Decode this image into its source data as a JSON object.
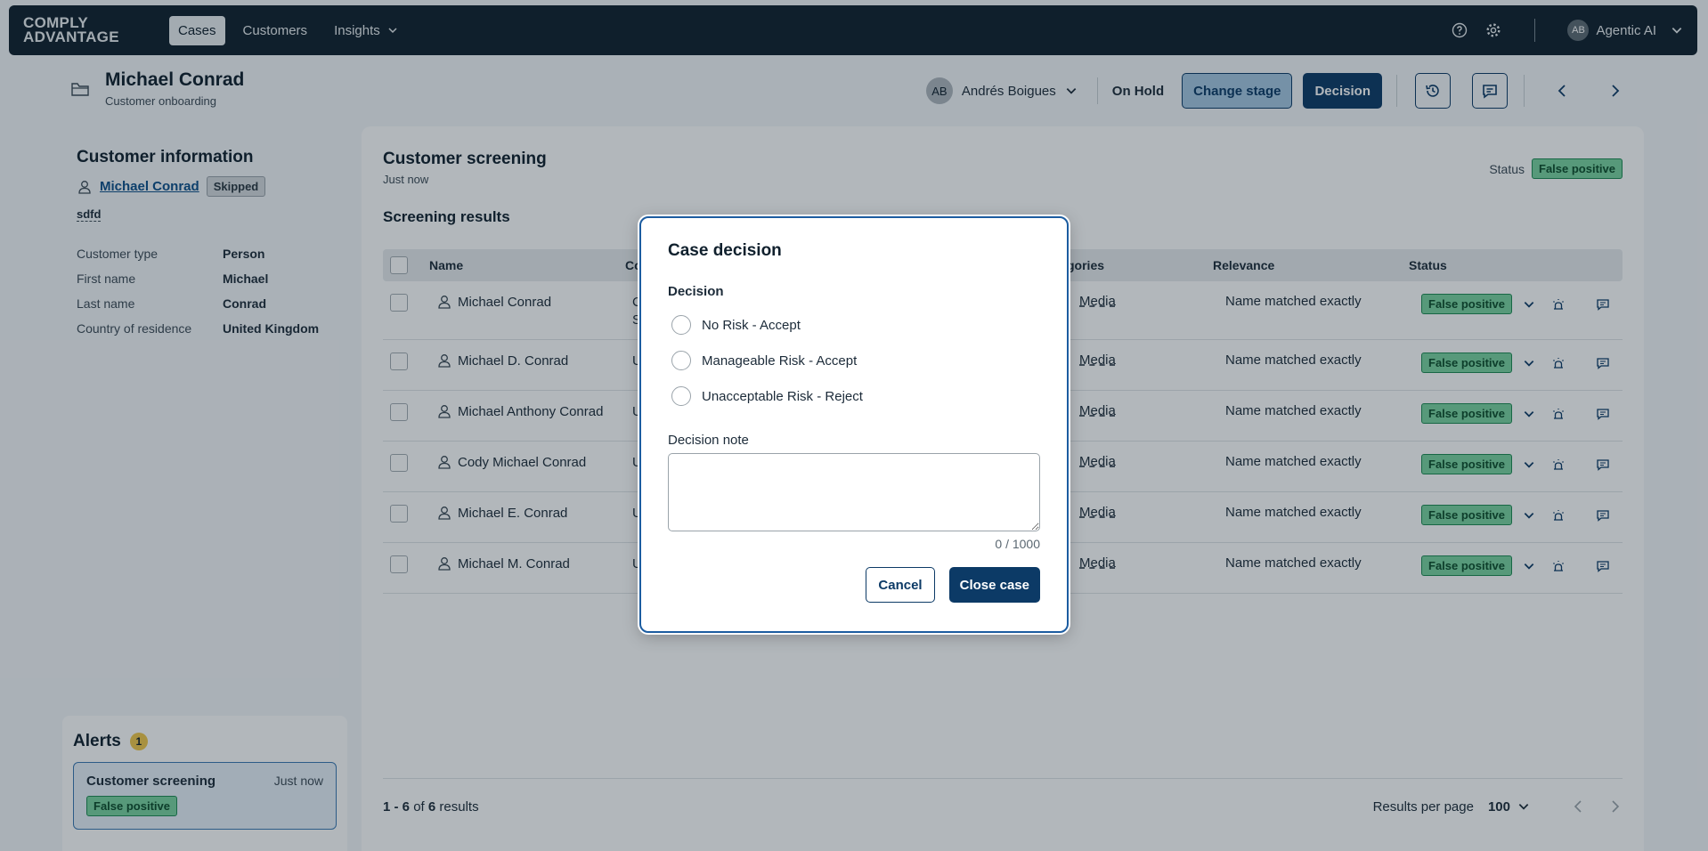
{
  "app": {
    "logo_line1": "COMPLY",
    "logo_line2": "ADVANTAGE",
    "nav": [
      "Cases",
      "Customers",
      "Insights"
    ],
    "user_initials": "AB",
    "user_name": "Agentic AI"
  },
  "header": {
    "title": "Michael Conrad",
    "subtitle": "Customer onboarding",
    "assignee_initials": "AB",
    "assignee_name": "Andrés Boigues",
    "stage": "On Hold",
    "change_stage": "Change stage",
    "decision": "Decision"
  },
  "customer": {
    "heading": "Customer information",
    "name": "Michael Conrad",
    "badge": "Skipped",
    "tag": "sdfd",
    "fields": [
      {
        "k": "Customer type",
        "v": "Person"
      },
      {
        "k": "First name",
        "v": "Michael"
      },
      {
        "k": "Last name",
        "v": "Conrad"
      },
      {
        "k": "Country of residence",
        "v": "United Kingdom"
      }
    ]
  },
  "alerts": {
    "title": "Alerts",
    "count": "1",
    "item_title": "Customer screening",
    "item_time": "Just now",
    "item_status": "False positive"
  },
  "screening": {
    "title": "Customer screening",
    "time": "Just now",
    "status_label": "Status",
    "status_value": "False positive",
    "section": "Screening results",
    "columns": [
      "Name",
      "Co",
      "gories",
      "Relevance",
      "Status"
    ],
    "rows": [
      {
        "name": "Michael Conrad",
        "country_l1": "Ca",
        "country_l2": "St",
        "category": "Media",
        "relevance": "Name matched exactly",
        "status": "False positive"
      },
      {
        "name": "Michael D. Conrad",
        "country_l1": "Ur",
        "country_l2": "",
        "category": "Media",
        "relevance": "Name matched exactly",
        "status": "False positive"
      },
      {
        "name": "Michael Anthony Conrad",
        "country_l1": "Ur",
        "country_l2": "",
        "category": "Media",
        "relevance": "Name matched exactly",
        "status": "False positive"
      },
      {
        "name": "Cody Michael Conrad",
        "country_l1": "Ur",
        "country_l2": "",
        "category": "Media",
        "relevance": "Name matched exactly",
        "status": "False positive"
      },
      {
        "name": "Michael E. Conrad",
        "country_l1": "Ur",
        "country_l2": "",
        "category": "Media",
        "relevance": "Name matched exactly",
        "status": "False positive"
      },
      {
        "name": "Michael M. Conrad",
        "country_l1": "Ur",
        "country_l2": "",
        "category": "Media",
        "relevance": "Name matched exactly",
        "status": "False positive"
      }
    ],
    "footer_range": "1 - 6",
    "footer_of": "of",
    "footer_total": "6",
    "footer_results": "results",
    "rpp_label": "Results per page",
    "rpp_value": "100"
  },
  "modal": {
    "title": "Case decision",
    "decision_label": "Decision",
    "options": [
      "No Risk - Accept",
      "Manageable Risk - Accept",
      "Unacceptable Risk - Reject"
    ],
    "note_label": "Decision note",
    "note_value": "",
    "counter": "0 / 1000",
    "cancel": "Cancel",
    "confirm": "Close case"
  }
}
